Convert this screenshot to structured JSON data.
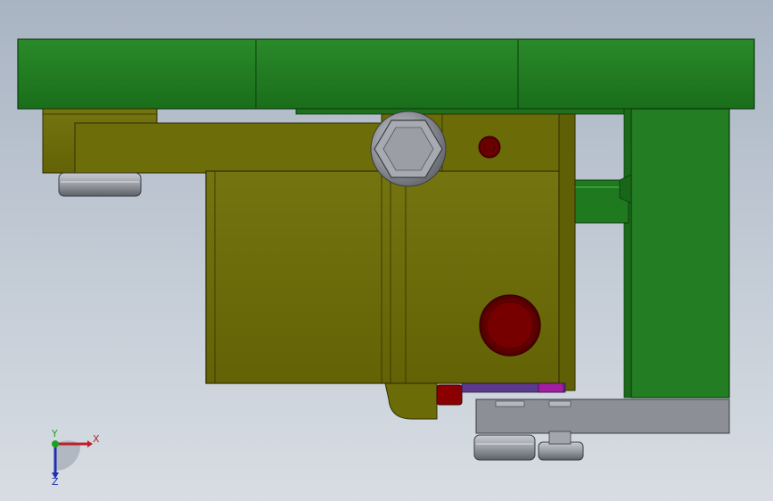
{
  "viewport": {
    "background_top": "#a9b4c3",
    "background_bottom": "#d8dde3"
  },
  "colors": {
    "green_part": "#1f7a1f",
    "green_edge": "#0d3b0d",
    "olive_part": "#6b6b08",
    "olive_edge": "#2f2f00",
    "steel": "#8f9199",
    "dark_red": "#7a0000",
    "purple": "#8a1a8a"
  },
  "triad": {
    "x_label": "X",
    "y_label": "Y",
    "z_label": "Z",
    "x_color": "#c0202a",
    "y_color": "#20a020",
    "z_color": "#2030b0"
  }
}
